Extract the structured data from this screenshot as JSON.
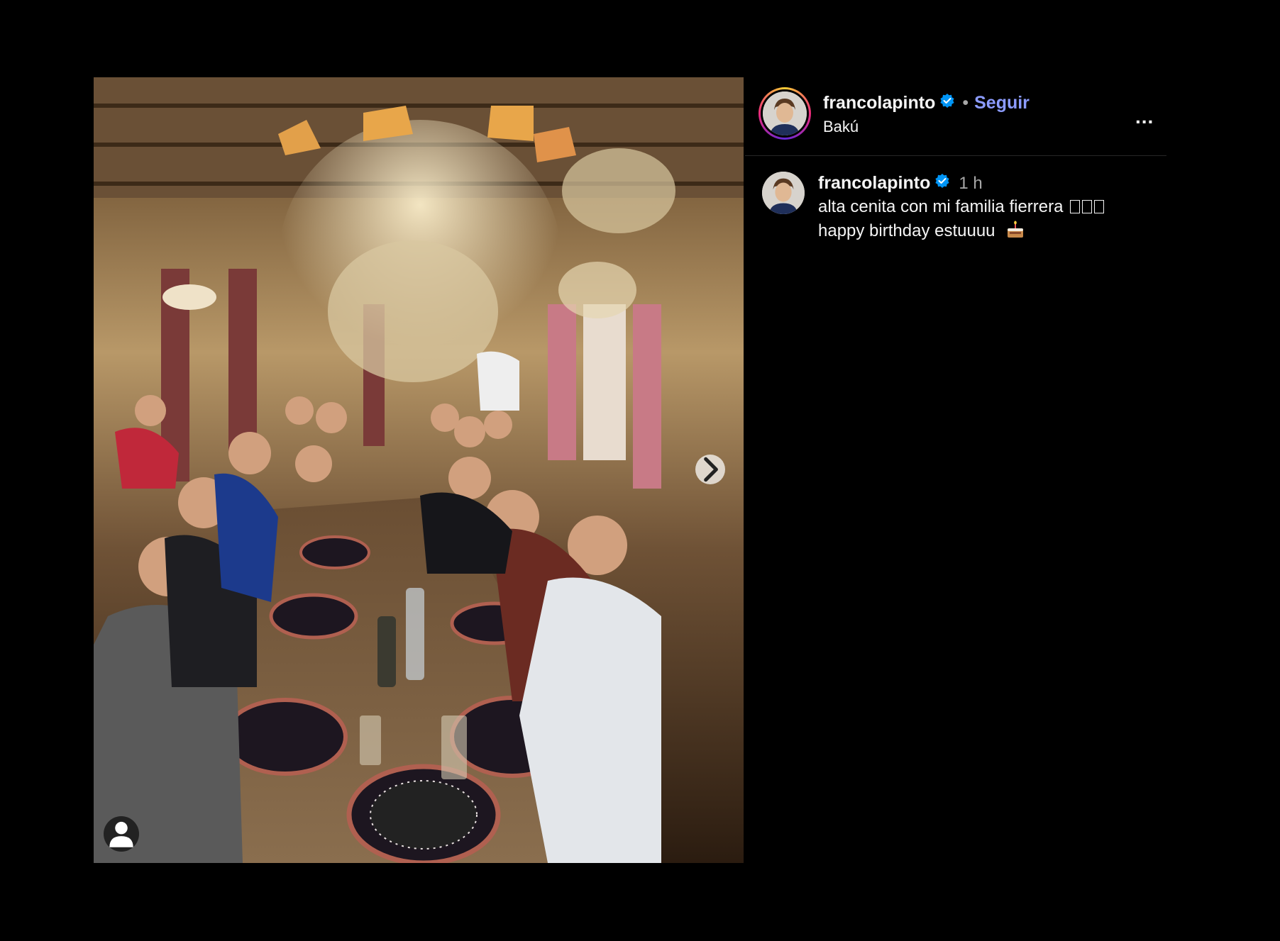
{
  "post": {
    "image_alt": "Group dinner photo",
    "has_next_image": true
  },
  "header": {
    "username": "francolapinto",
    "separator": "•",
    "follow_label": "Seguir",
    "location": "Bakú",
    "more_label": "..."
  },
  "caption": {
    "username": "francolapinto",
    "time": "1 h",
    "line1": "alta cenita con mi familia fierrera",
    "line1_glyph_count": 3,
    "line2": "happy birthday estuuuu"
  },
  "icons": {
    "verified": "verified-badge-icon",
    "next": "chevron-right-icon",
    "tag": "user-tag-icon",
    "more": "more-options-icon",
    "cake": "cake-emoji-icon"
  },
  "colors": {
    "background": "#000000",
    "follow": "#8c9cff",
    "verified": "#0095f6",
    "secondary_text": "#a8a8a8"
  }
}
